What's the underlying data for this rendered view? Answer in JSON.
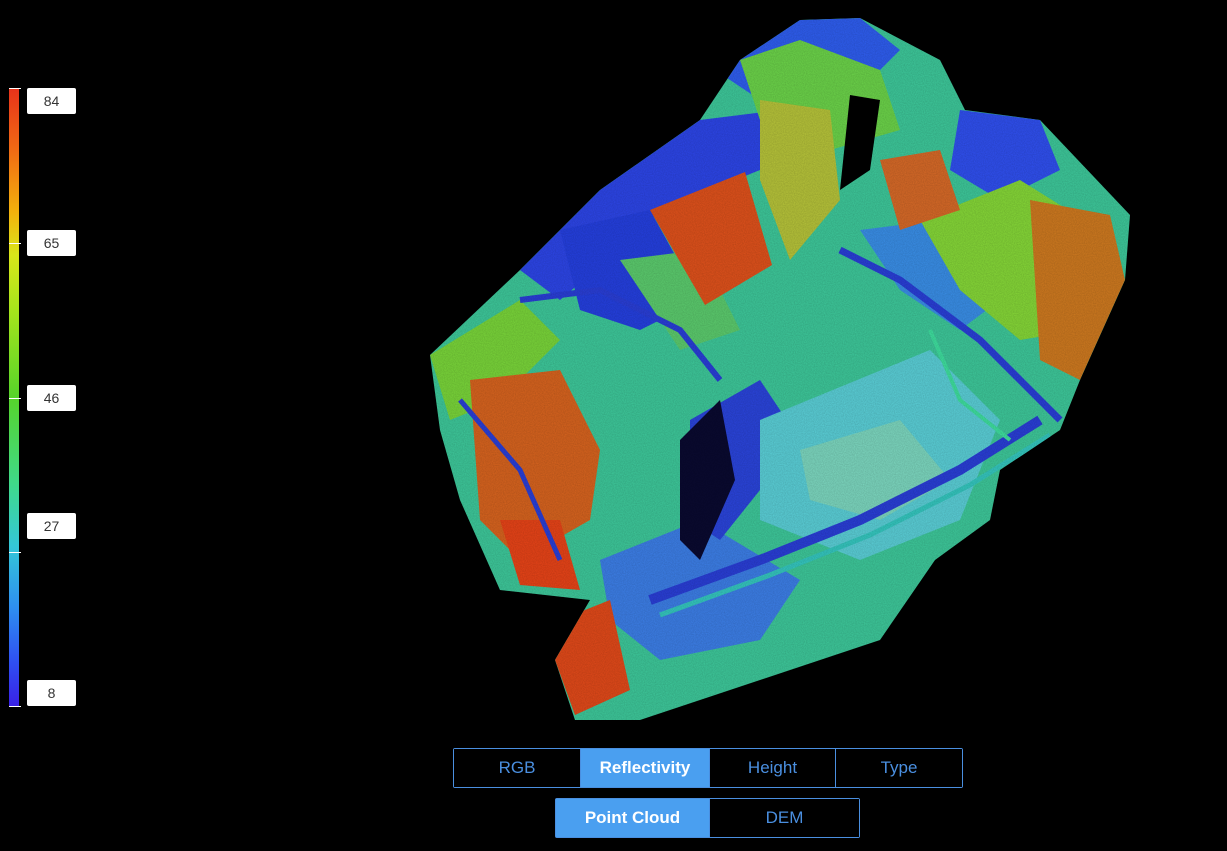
{
  "legend": {
    "labels": [
      "84",
      "65",
      "46",
      "27",
      "8"
    ]
  },
  "view_mode": {
    "options": [
      "RGB",
      "Reflectivity",
      "Height",
      "Type"
    ],
    "selected": "Reflectivity"
  },
  "data_type": {
    "options": [
      "Point Cloud",
      "DEM"
    ],
    "selected": "Point Cloud"
  },
  "colors": {
    "accent": "#4a9ff0",
    "border": "#4a8fe0",
    "background": "#000000"
  }
}
